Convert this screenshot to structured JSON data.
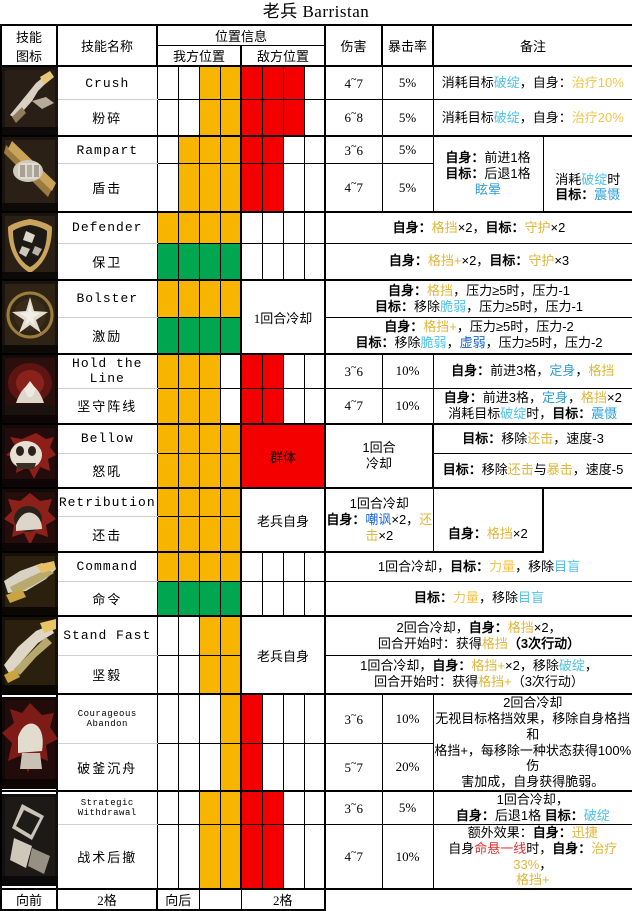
{
  "title": "老兵 Barristan",
  "headers": {
    "icon": [
      "技能",
      "图标"
    ],
    "skill_name": "技能名称",
    "position": "位置信息",
    "ally_position": "我方位置",
    "enemy_position": "敌方位置",
    "damage": "伤害",
    "crit": "暴击率",
    "notes": "备注"
  },
  "colors": {
    "ally": "#f7b500",
    "ally_upgraded": "#00a650",
    "enemy": "#f40000",
    "blank": "#ffffff",
    "keyword_blue": "#4fc3e8",
    "keyword_yellow": "#f0c44c",
    "keyword_dark_blue": "#1565d8",
    "keyword_green": "#6ecf4a",
    "keyword_red": "#e03030"
  },
  "footer": {
    "forward_label": "向前",
    "forward_value": "2格",
    "backward_label": "向后",
    "backward_value": "2格"
  },
  "skills": [
    {
      "id": "crush",
      "icon": "crush-icon",
      "name_en": "Crush",
      "name_cn": "粉碎",
      "ally_row1": [
        0,
        0,
        1,
        1
      ],
      "ally_row2": [
        0,
        0,
        1,
        1
      ],
      "enemy_row1": [
        1,
        1,
        1,
        0
      ],
      "enemy_row2": [
        1,
        1,
        1,
        0
      ],
      "damage_1": "4~7",
      "damage_2": "6~8",
      "crit_1": "5%",
      "crit_2": "5%",
      "note_1": "消耗目标破绽，自身：治疗10%",
      "note_2": "消耗目标破绽，自身：治疗20%"
    },
    {
      "id": "rampart",
      "icon": "rampart-icon",
      "name_en": "Rampart",
      "name_cn": "盾击",
      "ally_row1": [
        0,
        1,
        1,
        1
      ],
      "ally_row2": [
        0,
        1,
        1,
        1
      ],
      "enemy_row1": [
        1,
        1,
        0,
        0
      ],
      "enemy_row2": [
        1,
        1,
        0,
        0
      ],
      "damage_1": "3~6",
      "damage_2": "4~7",
      "crit_1": "5%",
      "crit_2": "5%",
      "note_main_l1": "自身：前进1格",
      "note_main_l2": "目标：后退1格",
      "note_main_l3": "眩晕",
      "note_side_l1": "消耗破绽时",
      "note_side_l2": "目标：震慑"
    },
    {
      "id": "defender",
      "icon": "defender-icon",
      "name_en": "Defender",
      "name_cn": "保卫",
      "ally_row1": [
        1,
        1,
        1,
        1
      ],
      "ally_row2": [
        2,
        2,
        2,
        2
      ],
      "enemy_row1": [
        0,
        0,
        0,
        0
      ],
      "enemy_row2": [
        0,
        0,
        0,
        0
      ],
      "note_1": "自身：格挡×2，目标：守护×2",
      "note_2": "自身：格挡+×2，目标：守护×3"
    },
    {
      "id": "bolster",
      "icon": "bolster-icon",
      "name_en": "Bolster",
      "name_cn": "激励",
      "ally_row1": [
        1,
        1,
        1,
        1
      ],
      "ally_row2": [
        2,
        2,
        2,
        2
      ],
      "cooldown": "1回合冷却",
      "note_1_l1": "自身：格挡，压力≥5时，压力-1",
      "note_1_l2": "目标：移除脆弱，压力≥5时，压力-1",
      "note_2_l1": "自身：格挡+，压力≥5时，压力-2",
      "note_2_l2": "目标：移除脆弱，虚弱，压力≥5时，压力-2"
    },
    {
      "id": "hold-the-line",
      "icon": "hold-the-line-icon",
      "name_en": "Hold the Line",
      "name_cn": "坚守阵线",
      "ally_row1": [
        1,
        1,
        1,
        0
      ],
      "ally_row2": [
        1,
        1,
        1,
        0
      ],
      "enemy_row1": [
        1,
        1,
        0,
        0
      ],
      "enemy_row2": [
        1,
        1,
        0,
        0
      ],
      "damage_1": "3~6",
      "damage_2": "4~7",
      "crit_1": "10%",
      "crit_2": "10%",
      "note_1": "自身：前进3格，定身，格挡",
      "note_2_l1": "自身：前进3格，定身，格挡×2",
      "note_2_l2": "消耗目标破绽时，目标：震慑"
    },
    {
      "id": "bellow",
      "icon": "bellow-icon",
      "name_en": "Bellow",
      "name_cn": "怒吼",
      "ally_row1": [
        1,
        1,
        1,
        1
      ],
      "ally_row2": [
        1,
        1,
        1,
        1
      ],
      "enemy_span": "群体",
      "cooldown_l1": "1回合",
      "cooldown_l2": "冷却",
      "note_1": "目标：移除还击，速度-3",
      "note_2": "目标：移除还击与暴击，速度-5"
    },
    {
      "id": "retribution",
      "icon": "retribution-icon",
      "name_en": "Retribution",
      "name_cn": "还击",
      "ally_row1": [
        1,
        1,
        1,
        1
      ],
      "ally_row2": [
        1,
        1,
        1,
        1
      ],
      "enemy_span": "老兵自身",
      "note_main_l1": "1回合冷却",
      "note_main_l2": "自身：嘲讽×2，还击×2",
      "note_side": "自身：格挡×2"
    },
    {
      "id": "command",
      "icon": "command-icon",
      "name_en": "Command",
      "name_cn": "命令",
      "ally_row1": [
        1,
        1,
        1,
        1
      ],
      "ally_row2": [
        2,
        2,
        2,
        2
      ],
      "enemy_row1": [
        0,
        0,
        0,
        0
      ],
      "enemy_row2": [
        0,
        0,
        0,
        0
      ],
      "note_1": "1回合冷却，目标：力量，移除目盲",
      "note_2": "目标：力量，移除目盲"
    },
    {
      "id": "stand-fast",
      "icon": "stand-fast-icon",
      "name_en": "Stand Fast",
      "name_cn": "坚毅",
      "ally_row1": [
        0,
        0,
        1,
        1
      ],
      "ally_row2": [
        0,
        0,
        1,
        1
      ],
      "enemy_span": "老兵自身",
      "note_1_l1": "2回合冷却，自身：格挡×2，",
      "note_1_l2": "回合开始时：获得格挡（3次行动）",
      "note_2_l1": "1回合冷却，自身：格挡+×2，移除破绽，",
      "note_2_l2": "回合开始时：获得格挡+（3次行动）"
    },
    {
      "id": "courageous-abandon",
      "icon": "courageous-abandon-icon",
      "name_en": "Courageous Abandon",
      "name_cn": "破釜沉舟",
      "ally_row1": [
        0,
        0,
        0,
        1
      ],
      "ally_row2": [
        0,
        0,
        0,
        1
      ],
      "enemy_row1": [
        1,
        0,
        0,
        0
      ],
      "enemy_row2": [
        1,
        0,
        0,
        0
      ],
      "damage_1": "3~6",
      "damage_2": "5~7",
      "crit_1": "10%",
      "crit_2": "20%",
      "note_l1": "2回合冷却",
      "note_l2": "无视目标格挡效果，移除自身格挡和",
      "note_l3": "格挡+，每移除一种状态获得100%伤",
      "note_l4": "害加成，自身获得脆弱。"
    },
    {
      "id": "strategic-withdrawal",
      "icon": "strategic-withdrawal-icon",
      "name_en": "Strategic Withdrawal",
      "name_cn": "战术后撤",
      "ally_row1": [
        0,
        0,
        1,
        1
      ],
      "ally_row2": [
        0,
        0,
        1,
        1
      ],
      "enemy_row1": [
        1,
        1,
        0,
        0
      ],
      "enemy_row2": [
        1,
        1,
        0,
        0
      ],
      "damage_1": "3~6",
      "damage_2": "4~7",
      "crit_1": "5%",
      "crit_2": "10%",
      "note_1_l1": "1回合冷却，",
      "note_1_l2": "自身：后退1格 目标：破绽",
      "note_2_l1": "额外效果：自身：迅捷",
      "note_2_l2": "自身命悬一线时，自身：治疗33%，",
      "note_2_l3": "格挡+"
    }
  ]
}
